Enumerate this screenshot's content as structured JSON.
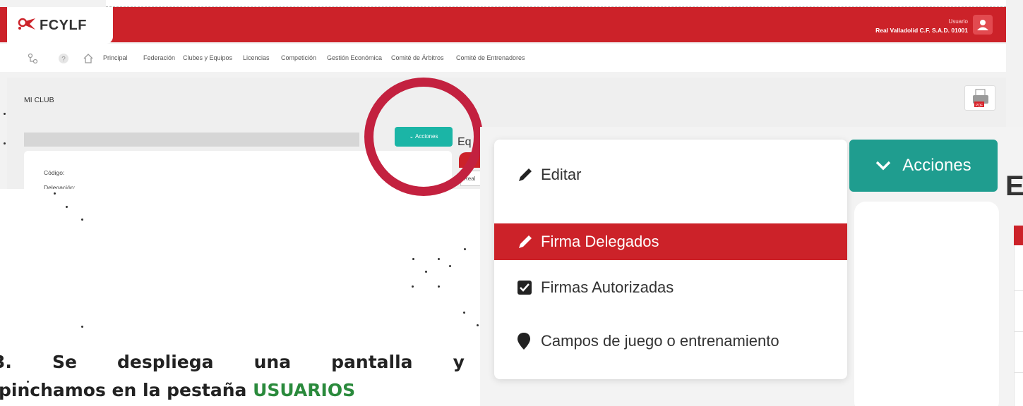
{
  "header": {
    "logo_text": "FCYLF",
    "user_label": "Usuario",
    "user_club": "Real Valladolid C.F. S.A.D. 01001"
  },
  "nav": {
    "items": [
      "Principal",
      "Federación",
      "Clubes y Equipos",
      "Licencias",
      "Competición",
      "Gestión Económica",
      "Comité de Árbitros",
      "Comité de Entrenadores"
    ]
  },
  "page": {
    "title": "MI CLUB",
    "fields": [
      "Código:",
      "Delegación:"
    ],
    "side_heading_partial": "Eq",
    "side_cell_partial": "Real"
  },
  "actions": {
    "button_label": "Acciones",
    "menu": [
      {
        "label": "Editar",
        "icon": "pencil-icon"
      },
      {
        "label": "Firma Delegados",
        "icon": "pencil-icon",
        "active": true
      },
      {
        "label": "Firmas Autorizadas",
        "icon": "checkbox-icon"
      },
      {
        "label": "Campos de juego o entrenamiento",
        "icon": "map-marker-icon"
      }
    ],
    "zoom_heading_partial": "E"
  },
  "caption": {
    "line1_words": [
      "3.",
      "Se",
      "despliega",
      "una",
      "pantalla",
      "y"
    ],
    "line2_prefix": "pinchamos en la pestaña ",
    "line2_highlight": "USUARIOS"
  },
  "colors": {
    "brand_red": "#cc2229",
    "teal": "#1bb5a6",
    "circle": "#c3213f",
    "highlight_green": "#2a8a3c"
  }
}
